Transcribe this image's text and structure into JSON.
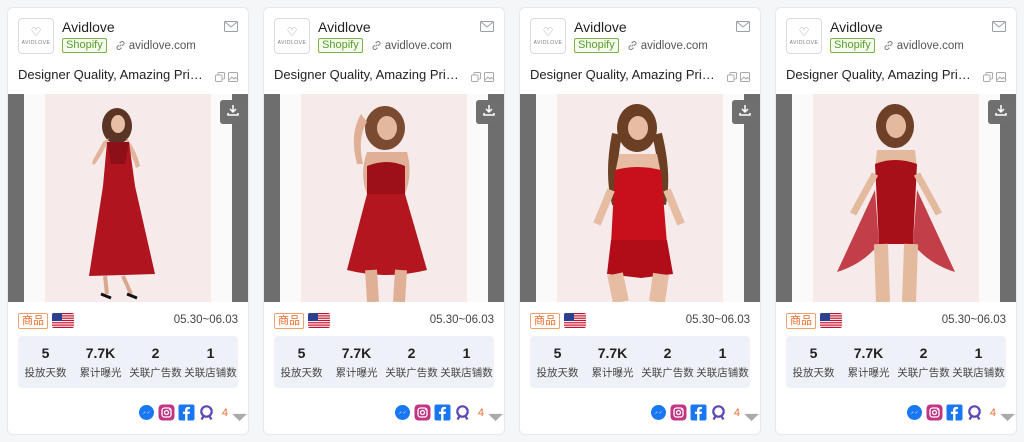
{
  "colors": {
    "accent_orange": "#e8692c",
    "shopify_green": "#5a9e2a",
    "dress_red": "#b0141f"
  },
  "cards": [
    {
      "brand": "Avidlove",
      "logo_text": "AVIDLOVE",
      "platform": "Shopify",
      "domain": "avidlove.com",
      "title": "Designer Quality, Amazing Pric...",
      "badge": "商品",
      "date_range": "05.30~06.03",
      "stats": [
        {
          "value": "5",
          "label": "投放天数"
        },
        {
          "value": "7.7K",
          "label": "累计曝光"
        },
        {
          "value": "2",
          "label": "关联广告数"
        },
        {
          "value": "1",
          "label": "关联店铺数"
        }
      ],
      "social": [
        "messenger-icon",
        "instagram-icon",
        "facebook-icon",
        "audience-network-icon"
      ],
      "social_count": "4"
    },
    {
      "brand": "Avidlove",
      "logo_text": "AVIDLOVE",
      "platform": "Shopify",
      "domain": "avidlove.com",
      "title": "Designer Quality, Amazing Pric...",
      "badge": "商品",
      "date_range": "05.30~06.03",
      "stats": [
        {
          "value": "5",
          "label": "投放天数"
        },
        {
          "value": "7.7K",
          "label": "累计曝光"
        },
        {
          "value": "2",
          "label": "关联广告数"
        },
        {
          "value": "1",
          "label": "关联店铺数"
        }
      ],
      "social": [
        "messenger-icon",
        "instagram-icon",
        "facebook-icon",
        "audience-network-icon"
      ],
      "social_count": "4"
    },
    {
      "brand": "Avidlove",
      "logo_text": "AVIDLOVE",
      "platform": "Shopify",
      "domain": "avidlove.com",
      "title": "Designer Quality, Amazing Pric...",
      "badge": "商品",
      "date_range": "05.30~06.03",
      "stats": [
        {
          "value": "5",
          "label": "投放天数"
        },
        {
          "value": "7.7K",
          "label": "累计曝光"
        },
        {
          "value": "2",
          "label": "关联广告数"
        },
        {
          "value": "1",
          "label": "关联店铺数"
        }
      ],
      "social": [
        "messenger-icon",
        "instagram-icon",
        "facebook-icon",
        "audience-network-icon"
      ],
      "social_count": "4"
    },
    {
      "brand": "Avidlove",
      "logo_text": "AVIDLOVE",
      "platform": "Shopify",
      "domain": "avidlove.com",
      "title": "Designer Quality, Amazing Pric...",
      "badge": "商品",
      "date_range": "05.30~06.03",
      "stats": [
        {
          "value": "5",
          "label": "投放天数"
        },
        {
          "value": "7.7K",
          "label": "累计曝光"
        },
        {
          "value": "2",
          "label": "关联广告数"
        },
        {
          "value": "1",
          "label": "关联店铺数"
        }
      ],
      "social": [
        "messenger-icon",
        "instagram-icon",
        "facebook-icon",
        "audience-network-icon"
      ],
      "social_count": "4"
    }
  ]
}
